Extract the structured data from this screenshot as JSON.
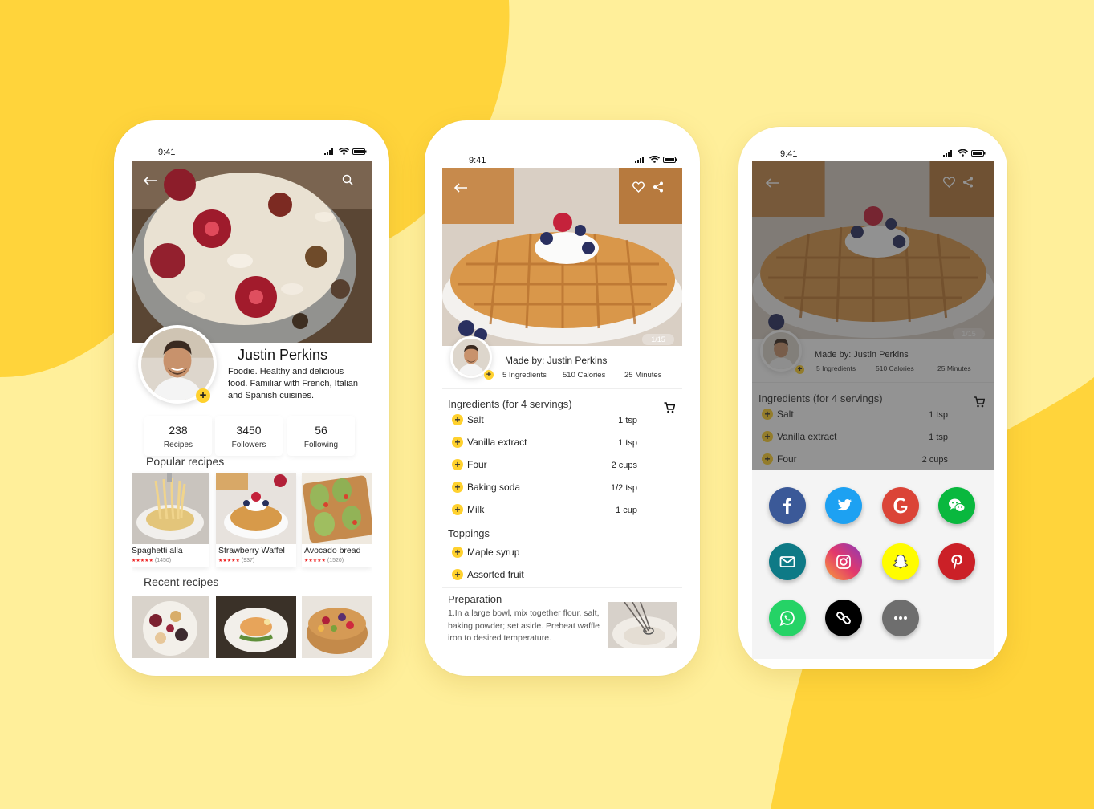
{
  "status": {
    "time": "9:41"
  },
  "profile": {
    "name": "Justin Perkins",
    "bio": "Foodie. Healthy and delicious food. Familiar with French, Italian and Spanish cuisines.",
    "stats": [
      {
        "value": "238",
        "label": "Recipes"
      },
      {
        "value": "3450",
        "label": "Followers"
      },
      {
        "value": "56",
        "label": "Following"
      }
    ],
    "popular_title": "Popular recipes",
    "popular": [
      {
        "title": "Spaghetti alla",
        "stars": "★★★★★",
        "count": "(1450)"
      },
      {
        "title": "Strawberry Waffel",
        "stars": "★★★★★",
        "count": "(937)"
      },
      {
        "title": "Avocado bread",
        "stars": "★★★★★",
        "count": "(1520)"
      }
    ],
    "recent_title": "Recent recipes"
  },
  "recipe": {
    "image_counter": "1/15",
    "made_by": "Made by: Justin Perkins",
    "meta": {
      "ingredients": "5 Ingredients",
      "calories": "510 Calories",
      "time": "25 Minutes"
    },
    "ingredients_title": "Ingredients (for 4 servings)",
    "ingredients": [
      {
        "name": "Salt",
        "qty": "1 tsp"
      },
      {
        "name": "Vanilla extract",
        "qty": "1 tsp"
      },
      {
        "name": "Four",
        "qty": "2 cups"
      },
      {
        "name": "Baking soda",
        "qty": "1/2 tsp"
      },
      {
        "name": "Milk",
        "qty": "1 cup"
      }
    ],
    "toppings_title": "Toppings",
    "toppings": [
      {
        "name": "Maple syrup"
      },
      {
        "name": "Assorted fruit"
      }
    ],
    "preparation_title": "Preparation",
    "preparation_text": "1.In a large bowl, mix together flour, salt, baking powder; set aside. Preheat waffle iron to desired temperature."
  },
  "share": {
    "buttons": [
      {
        "name": "facebook",
        "color": "#3B5998"
      },
      {
        "name": "twitter",
        "color": "#1DA1F2"
      },
      {
        "name": "google",
        "color": "#DB4437"
      },
      {
        "name": "wechat",
        "color": "#09B83E"
      },
      {
        "name": "email",
        "color": "#0E7A86"
      },
      {
        "name": "instagram",
        "color": "#C13584"
      },
      {
        "name": "snapchat",
        "color": "#FFFC00"
      },
      {
        "name": "pinterest",
        "color": "#CB2027"
      },
      {
        "name": "whatsapp",
        "color": "#25D366"
      },
      {
        "name": "link",
        "color": "#000000"
      },
      {
        "name": "more",
        "color": "#6E6E6E"
      }
    ]
  },
  "colors": {
    "accent": "#FFD12E",
    "background_light": "#FFEF9A",
    "background_dark": "#FFD43B"
  }
}
